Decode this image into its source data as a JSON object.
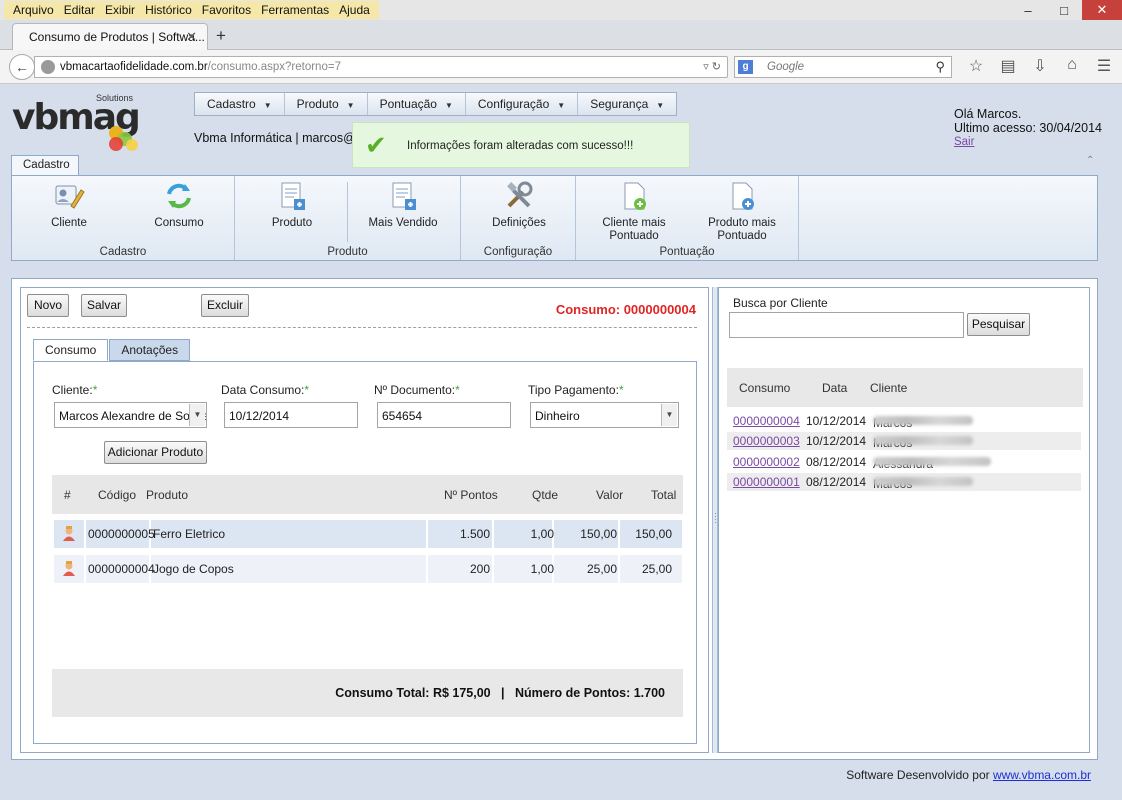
{
  "browser": {
    "menu": [
      "Arquivo",
      "Editar",
      "Exibir",
      "Histórico",
      "Favoritos",
      "Ferramentas",
      "Ajuda"
    ],
    "tab_title": "Consumo de Produtos | Softwa...",
    "url_host": "vbmacartaofidelidade.com.br",
    "url_path": "/consumo.aspx?retorno=7",
    "search_placeholder": "Google"
  },
  "header": {
    "logo_suffix": "Solutions",
    "nav": [
      "Cadastro",
      "Produto",
      "Pontuação",
      "Configuração",
      "Segurança"
    ],
    "company": "Vbma Informática | marcos@vb",
    "success_message": "Informações foram alteradas com sucesso!!!",
    "greeting": "Olá Marcos.",
    "last_access": "Ultimo acesso: 30/04/2014",
    "logout": "Sair"
  },
  "ribbon": {
    "tab": "Cadastro",
    "groups": [
      {
        "label": "Cadastro",
        "buttons": [
          "Cliente",
          "Consumo"
        ]
      },
      {
        "label": "Produto",
        "buttons": [
          "Produto",
          "Mais Vendido"
        ]
      },
      {
        "label": "Configuração",
        "buttons": [
          "Definições"
        ]
      },
      {
        "label": "Pontuação",
        "buttons": [
          "Cliente mais\nPontuado",
          "Produto mais\nPontuado"
        ]
      }
    ]
  },
  "form": {
    "buttons": {
      "novo": "Novo",
      "salvar": "Salvar",
      "excluir": "Excluir"
    },
    "title": "Consumo: 0000000004",
    "tabs": [
      "Consumo",
      "Anotações"
    ],
    "fields": {
      "cliente_label": "Cliente:",
      "cliente_value": "Marcos Alexandre de Souza",
      "data_label": "Data Consumo:",
      "data_value": "10/12/2014",
      "documento_label": "Nº Documento:",
      "documento_value": "654654",
      "pagamento_label": "Tipo Pagamento:",
      "pagamento_value": "Dinheiro",
      "required_mark": "*"
    },
    "add_product": "Adicionar Produto",
    "grid": {
      "columns": [
        "#",
        "Código",
        "Produto",
        "Nº Pontos",
        "Qtde",
        "Valor",
        "Total"
      ],
      "rows": [
        {
          "codigo": "0000000005",
          "produto": "Ferro Eletrico",
          "pontos": "1.500",
          "qtde": "1,00",
          "valor": "150,00",
          "total": "150,00"
        },
        {
          "codigo": "0000000004",
          "produto": "Jogo de Copos",
          "pontos": "200",
          "qtde": "1,00",
          "valor": "25,00",
          "total": "25,00"
        }
      ]
    },
    "total": "Consumo Total: R$ 175,00   |   Número de Pontos: 1.700"
  },
  "search": {
    "label": "Busca por Cliente",
    "button": "Pesquisar",
    "columns": [
      "Consumo",
      "Data",
      "Cliente"
    ],
    "rows": [
      {
        "consumo": "0000000004",
        "data": "10/12/2014",
        "cliente": "Marcos"
      },
      {
        "consumo": "0000000003",
        "data": "10/12/2014",
        "cliente": "Marcos"
      },
      {
        "consumo": "0000000002",
        "data": "08/12/2014",
        "cliente": "Alessandra"
      },
      {
        "consumo": "0000000001",
        "data": "08/12/2014",
        "cliente": "Marcos"
      }
    ]
  },
  "footer": {
    "text": "Software Desenvolvido por ",
    "link": "www.vbma.com.br"
  }
}
